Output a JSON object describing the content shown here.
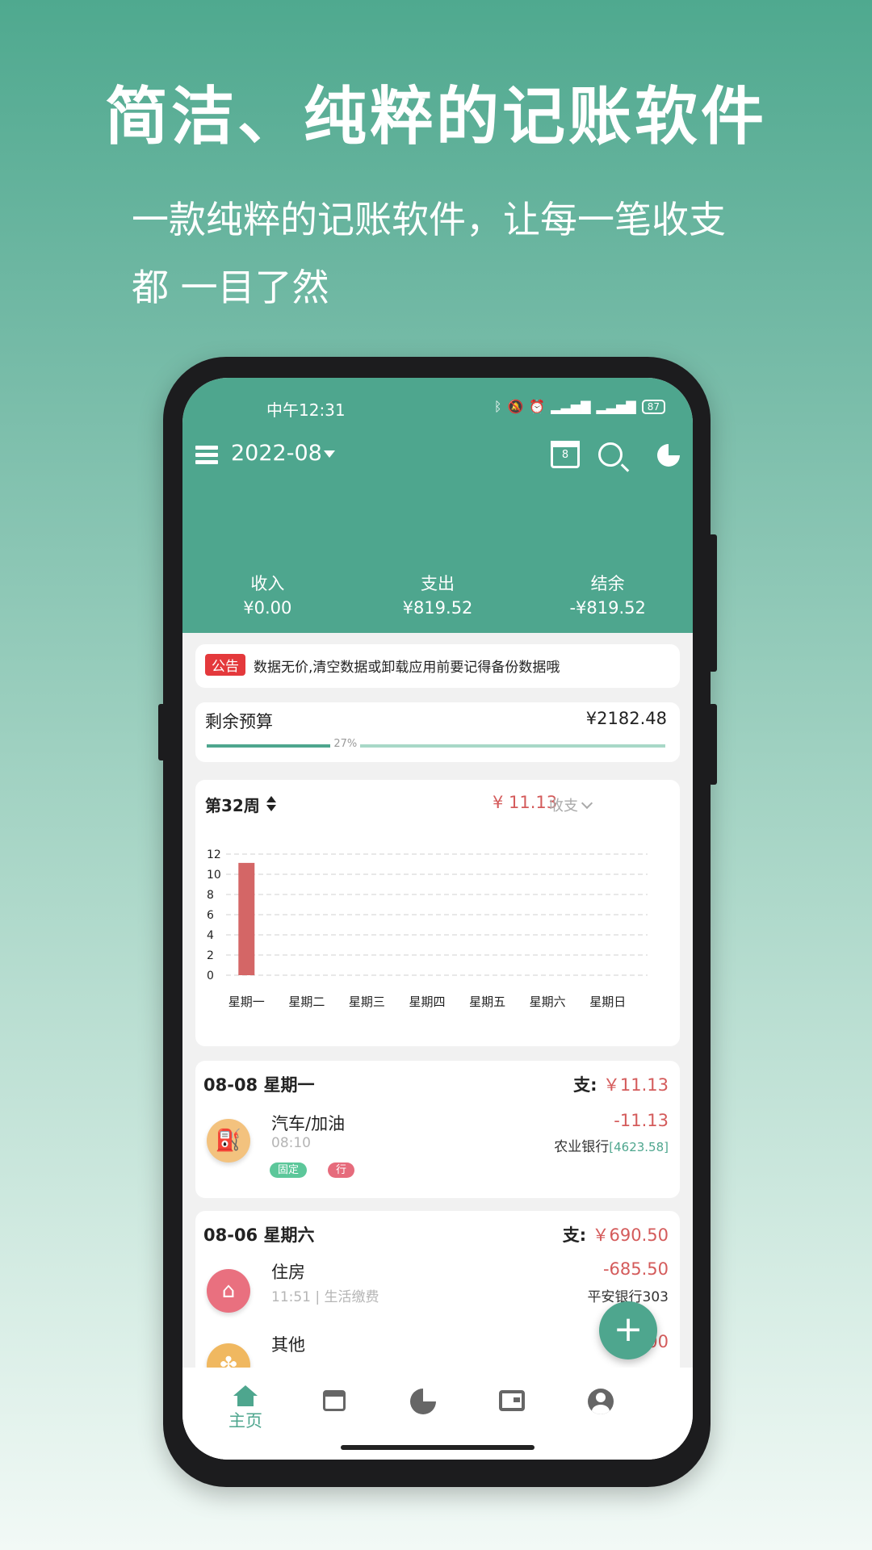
{
  "promo": {
    "headline": "简洁、纯粹的记账软件",
    "subline_1": "一款纯粹的记账软件，让每一笔收支",
    "subline_2": "都 一目了然"
  },
  "status_bar": {
    "time": "中午12:31",
    "battery": "87"
  },
  "toolbar": {
    "month": "2022-08",
    "calendar_day": "8"
  },
  "summary": {
    "income_label": "收入",
    "income_value": "¥0.00",
    "expense_label": "支出",
    "expense_value": "¥819.52",
    "balance_label": "结余",
    "balance_value": "-¥819.52"
  },
  "notice": {
    "tag": "公告",
    "text": "数据无价,清空数据或卸载应用前要记得备份数据哦"
  },
  "budget": {
    "label": "剩余预算",
    "value": "¥2182.48",
    "percent_text": "27%",
    "percent": 27
  },
  "chart_header": {
    "week": "第32周",
    "total": "¥ 11.13",
    "type": "收支"
  },
  "chart_data": {
    "type": "bar",
    "categories": [
      "星期一",
      "星期二",
      "星期三",
      "星期四",
      "星期五",
      "星期六",
      "星期日"
    ],
    "values": [
      11.13,
      0,
      0,
      0,
      0,
      0,
      0
    ],
    "yticks": [
      0,
      2,
      4,
      6,
      8,
      10,
      12
    ],
    "ylim": [
      0,
      12
    ],
    "bar_color": "#d46666",
    "grid": true
  },
  "days": [
    {
      "date": "08-08 星期一",
      "sum_label": "支:",
      "sum_value": "￥11.13",
      "items": [
        {
          "icon": "gas-pump-icon",
          "title": "汽车/加油",
          "time": "08:10",
          "amount": "-11.13",
          "account": "农业银行",
          "balance": "[4623.58]",
          "tags": [
            "固定",
            "行"
          ]
        }
      ]
    },
    {
      "date": "08-06 星期六",
      "sum_label": "支:",
      "sum_value": "￥690.50",
      "items": [
        {
          "icon": "home-icon",
          "title": "住房",
          "time": "11:51",
          "category": "生活缴费",
          "amount": "-685.50",
          "account": "平安银行303"
        },
        {
          "icon": "clover-icon",
          "title": "其他",
          "amount": "-5.00"
        }
      ]
    }
  ],
  "bottom_nav": {
    "home_label": "主页"
  },
  "colors": {
    "primary": "#4ea68e",
    "expense": "#d45b5b",
    "notice": "#e4393c"
  }
}
